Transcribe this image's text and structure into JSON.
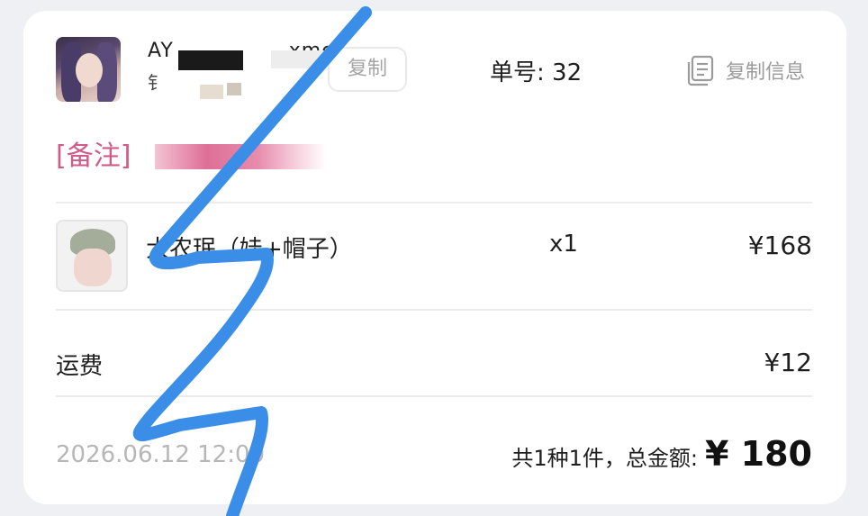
{
  "header": {
    "nickname": "AY",
    "nickname_suffix": "xme",
    "subline": "钅",
    "copy_button_label": "复制",
    "order_number_label": "单号: 32",
    "copy_info_label": "复制信息",
    "copy_info_icon": "document-copy-icon"
  },
  "note": {
    "label": "[备注]"
  },
  "product": {
    "name": "大农珉（娃+帽子）",
    "quantity": "x1",
    "price": "¥168",
    "thumbnail_icon": "plush-doll-image"
  },
  "shipping": {
    "label": "运费",
    "value": "¥12"
  },
  "footer": {
    "order_time": "2026.06.12 12:00",
    "summary_label": "共1种1件，总金额:",
    "total": "¥ 180"
  },
  "colors": {
    "note_pink": "#d05c87",
    "scribble_blue": "#3a8ee8",
    "muted_gray": "#9b9b9b",
    "background": "#eef0f3"
  }
}
